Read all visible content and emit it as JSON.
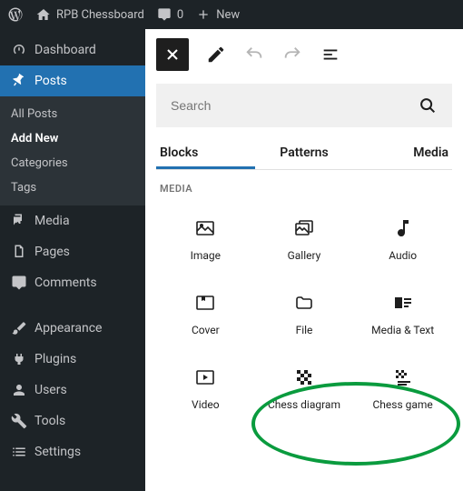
{
  "adminbar": {
    "site_name": "RPB Chessboard",
    "comments_count": "0",
    "new_label": "New"
  },
  "sidebar": {
    "dashboard": "Dashboard",
    "posts": "Posts",
    "posts_submenu": {
      "all_posts": "All Posts",
      "add_new": "Add New",
      "categories": "Categories",
      "tags": "Tags"
    },
    "media": "Media",
    "pages": "Pages",
    "comments": "Comments",
    "appearance": "Appearance",
    "plugins": "Plugins",
    "users": "Users",
    "tools": "Tools",
    "settings": "Settings"
  },
  "inserter": {
    "search_placeholder": "Search",
    "tabs": {
      "blocks": "Blocks",
      "patterns": "Patterns",
      "media": "Media"
    },
    "section_label": "MEDIA",
    "blocks": {
      "image": "Image",
      "gallery": "Gallery",
      "audio": "Audio",
      "cover": "Cover",
      "file": "File",
      "media_text": "Media & Text",
      "video": "Video",
      "chess_diagram": "Chess diagram",
      "chess_game": "Chess game"
    }
  }
}
